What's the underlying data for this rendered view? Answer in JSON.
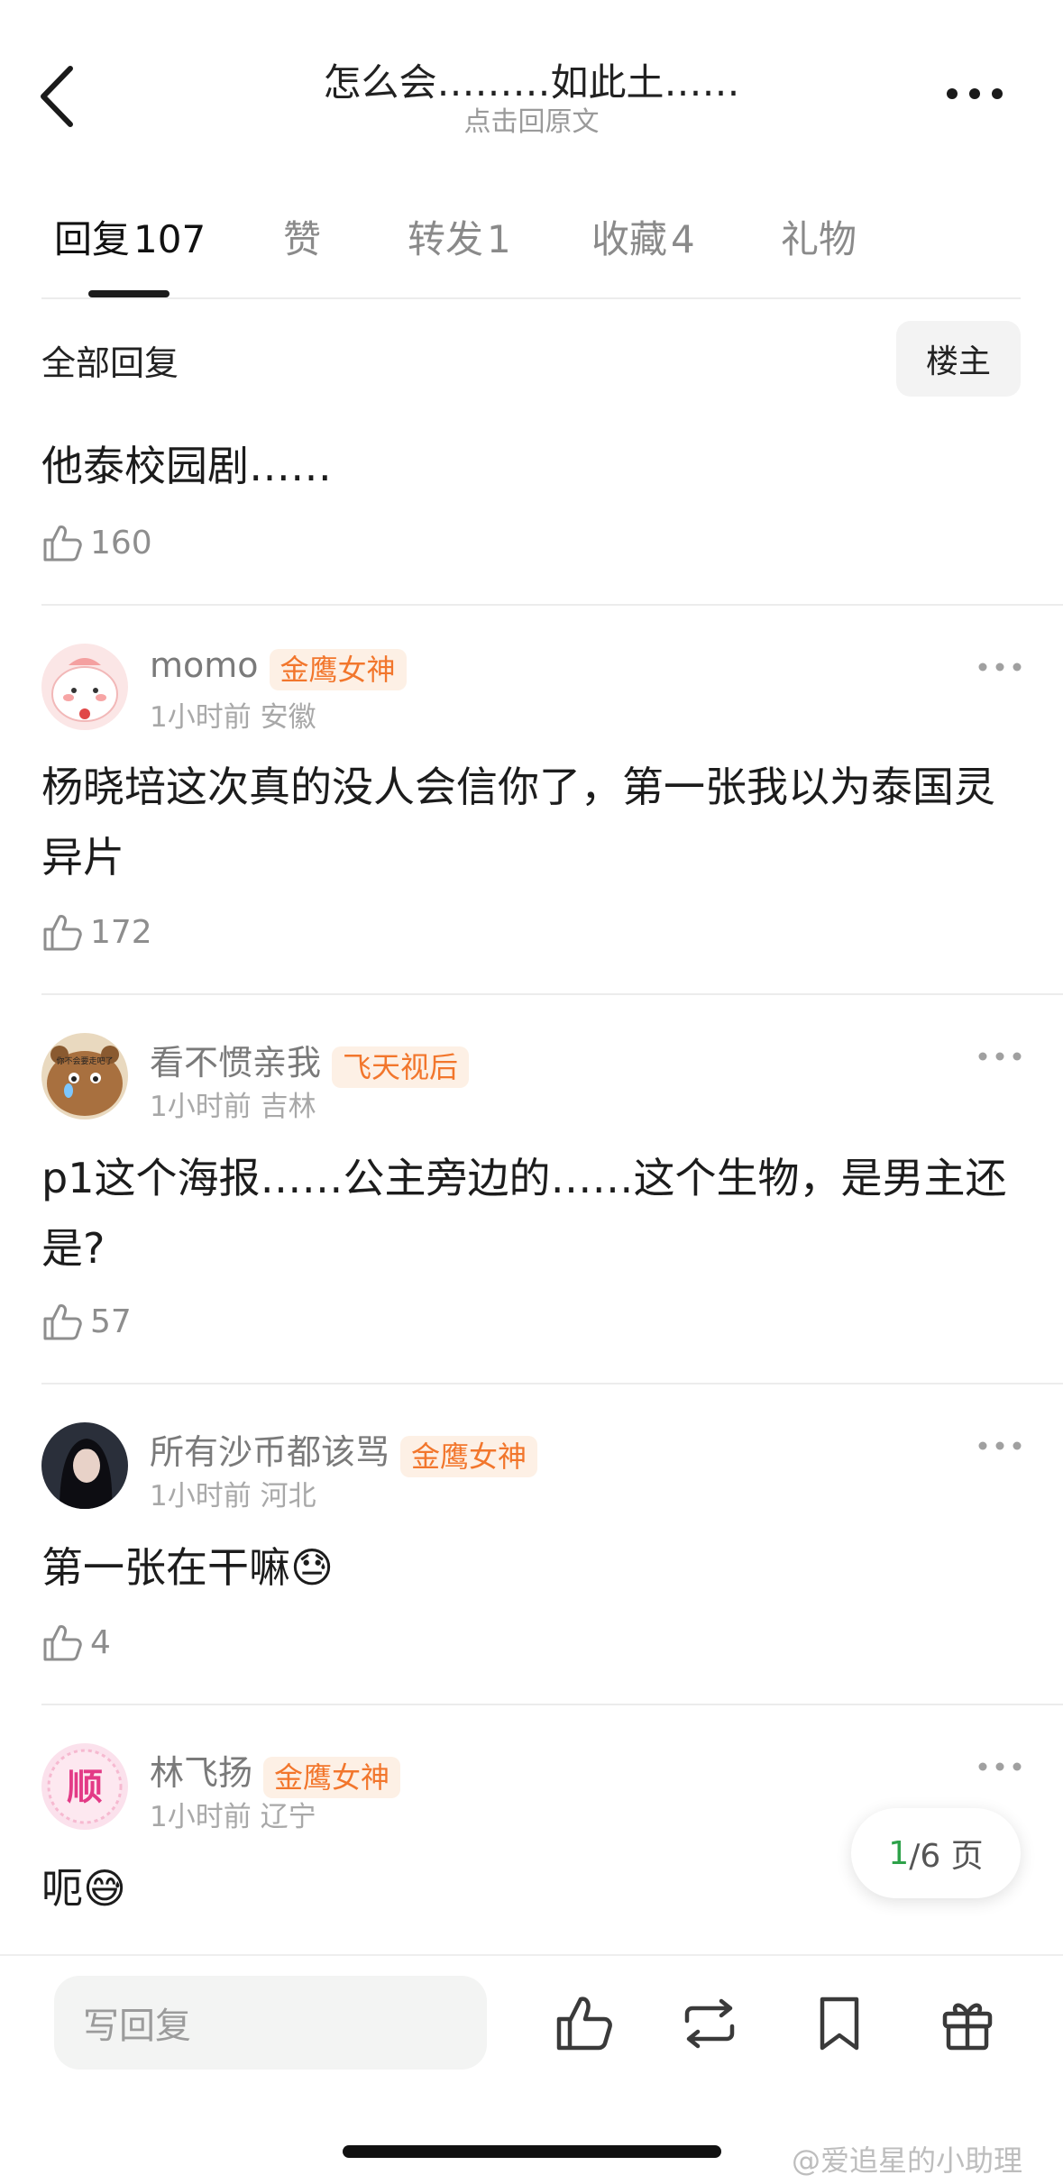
{
  "header": {
    "title": "怎么会………如此土……",
    "subtitle": "点击回原文"
  },
  "tabs": [
    {
      "label": "回复",
      "count": "107"
    },
    {
      "label": "赞",
      "count": ""
    },
    {
      "label": "转发",
      "count": "1"
    },
    {
      "label": "收藏",
      "count": "4"
    },
    {
      "label": "礼物",
      "count": ""
    }
  ],
  "filter": {
    "label": "全部回复",
    "owner_button": "楼主"
  },
  "top_comment": {
    "text": "他泰校园剧……",
    "likes": "160"
  },
  "comments": [
    {
      "name": "momo",
      "badge": "金鹰女神",
      "time": "1小时前",
      "location": "安徽",
      "text": "杨晓培这次真的没人会信你了，第一张我以为泰国灵异片",
      "likes": "172"
    },
    {
      "name": "看不惯亲我",
      "badge": "飞天视后",
      "time": "1小时前",
      "location": "吉林",
      "text": "p1这个海报……公主旁边的……这个生物，是男主还是?",
      "likes": "57",
      "avatar_text": "你不会要走吧了"
    },
    {
      "name": "所有沙币都该骂",
      "badge": "金鹰女神",
      "time": "1小时前",
      "location": "河北",
      "text": "第一张在干嘛😓",
      "likes": "4"
    },
    {
      "name": "林飞扬",
      "badge": "金鹰女神",
      "time": "1小时前",
      "location": "辽宁",
      "text": "呃😅",
      "likes": "",
      "avatar_text": "顺"
    }
  ],
  "pagination": {
    "current": "1",
    "total": "/6 页"
  },
  "bottom_bar": {
    "reply_placeholder": "写回复"
  },
  "watermark": "@爱追星的小助理",
  "colors": {
    "badge_text": "#f2762c",
    "badge_bg": "#fdf0e5",
    "page_current": "#2ea24a"
  }
}
